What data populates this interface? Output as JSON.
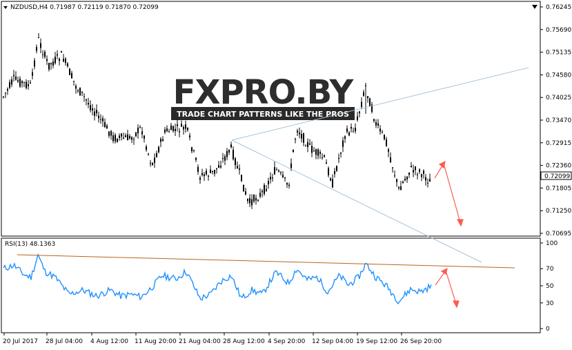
{
  "main_chart": {
    "symbol_line": "NZDUSD,H4  0.71987 0.72119 0.71870 0.72099",
    "price_ticks": [
      "0.76245",
      "0.75690",
      "0.75135",
      "0.74580",
      "0.74025",
      "0.73470",
      "0.72915",
      "0.72360",
      "0.71805",
      "0.71250",
      "0.70695"
    ],
    "current_price": "0.72099",
    "current_price_bg": "#ffffff",
    "watermark": {
      "logo_text": "FXPRO.BY",
      "tagline": "TRADE CHART PATTERNS LIKE THE PROS"
    }
  },
  "rsi_panel": {
    "label": "RSI(13) 48.1363",
    "ticks": [
      "100",
      "70",
      "50",
      "30",
      "0"
    ],
    "line_color": "#1e90ff"
  },
  "time_axis": {
    "labels": [
      "20 Jul 2017",
      "28 Jul 04:00",
      "4 Aug 12:00",
      "11 Aug 20:00",
      "21 Aug 04:00",
      "28 Aug 12:00",
      "4 Sep 20:00",
      "12 Sep 04:00",
      "19 Sep 12:00",
      "26 Sep 20:00"
    ]
  },
  "colors": {
    "candle": "#000000",
    "trendline": "#a9c3d6",
    "rsi_trendline": "#b5651d",
    "forecast_arrow": "#ff5a4e"
  },
  "icons": {
    "scroll_arrow": "down-triangle"
  }
}
